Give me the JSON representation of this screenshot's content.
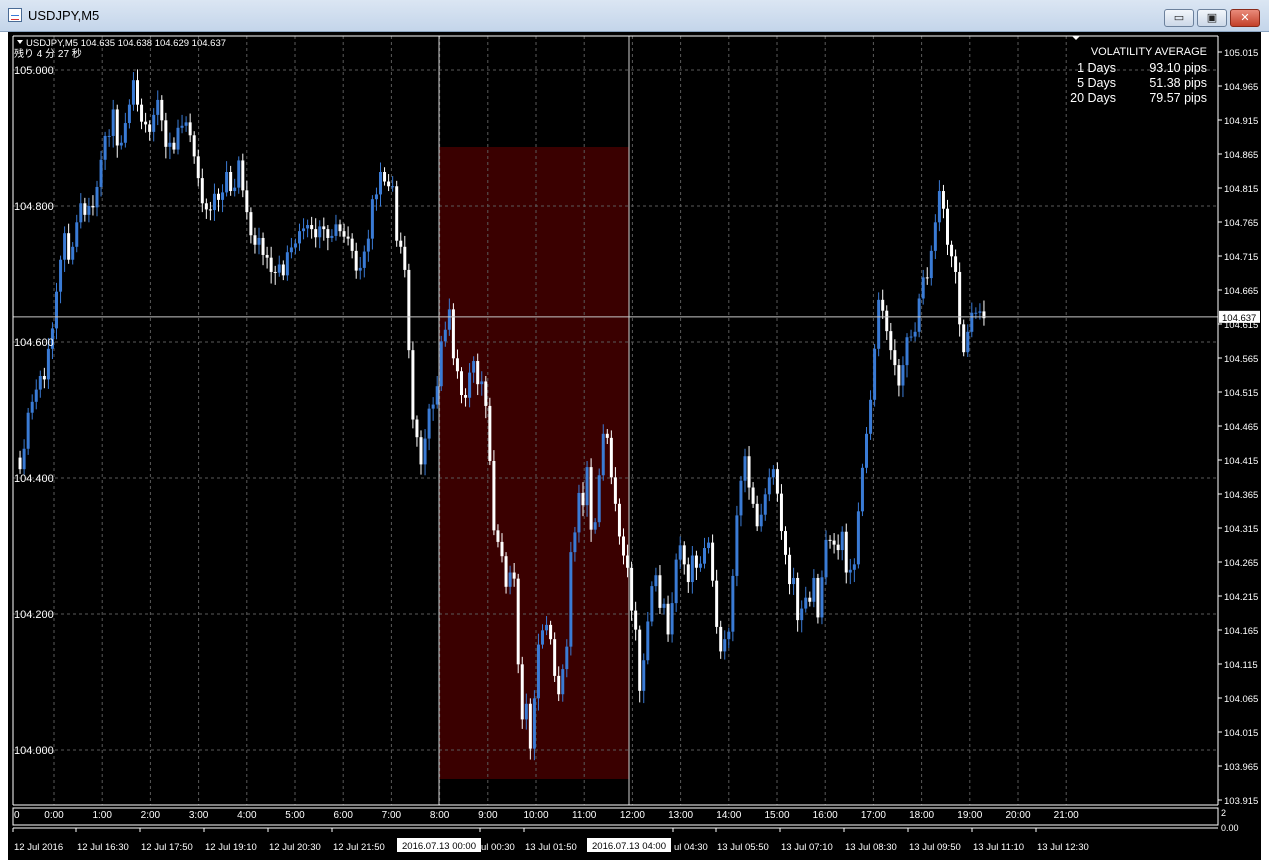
{
  "window": {
    "title": "USDJPY,M5",
    "controls": {
      "minimize": "▭",
      "maximize": "▣",
      "close": "✕"
    }
  },
  "chart_header": {
    "symbol_line": "USDJPY,M5  104.635 104.638 104.629 104.637",
    "countdown": "残り 4 分 27 秒"
  },
  "volatility": {
    "title": "VOLATILITY AVERAGE",
    "rows": [
      {
        "label": "1 Days",
        "value": "93.10 pips"
      },
      {
        "label": "5 Days",
        "value": "51.38 pips"
      },
      {
        "label": "20 Days",
        "value": "79.57 pips"
      }
    ]
  },
  "price_axis": {
    "left_labels": [
      "105.000",
      "104.800",
      "104.600",
      "104.400",
      "104.200",
      "104.000"
    ],
    "right_labels": [
      "105.015",
      "104.965",
      "104.915",
      "104.865",
      "104.815",
      "104.765",
      "104.715",
      "104.665",
      "104.615",
      "104.565",
      "104.515",
      "104.465",
      "104.415",
      "104.365",
      "104.315",
      "104.265",
      "104.215",
      "104.165",
      "104.115",
      "104.065",
      "104.015",
      "103.965",
      "103.915"
    ],
    "current_price": "104.637"
  },
  "time_axis": {
    "hour_labels": [
      "0",
      "0:00",
      "1:00",
      "2:00",
      "3:00",
      "4:00",
      "5:00",
      "6:00",
      "7:00",
      "8:00",
      "9:00",
      "10:00",
      "11:00",
      "12:00",
      "13:00",
      "14:00",
      "15:00",
      "16:00",
      "17:00",
      "18:00",
      "19:00",
      "20:00",
      "21:00"
    ],
    "date_labels": [
      "12 Jul 2016",
      "12 Jul 16:30",
      "12 Jul 17:50",
      "12 Jul 19:10",
      "12 Jul 20:30",
      "12 Jul 21:50",
      "ul 00:30",
      "13 Jul 01:50",
      "ul 04:30",
      "13 Jul 05:50",
      "13 Jul 07:10",
      "13 Jul 08:30",
      "13 Jul 09:50",
      "13 Jul 11:10",
      "13 Jul 12:30"
    ],
    "cursor_labels": [
      "2016.07.13 00:00",
      "2016.07.13 04:00"
    ]
  },
  "indicator_pane": {
    "scale_top": "2",
    "scale_bottom": "0.00"
  },
  "colors": {
    "background": "#000000",
    "bull": "#3a7bd5",
    "bear": "#ffffff",
    "range_box": "#3a0000",
    "grid": "#5a5a5a"
  },
  "chart_data": {
    "type": "candlestick",
    "series": [
      {
        "values": [
          104.43,
          104.413,
          104.443,
          104.496,
          104.512,
          104.53,
          104.55,
          104.545,
          104.59,
          104.62,
          104.674,
          104.721,
          104.76,
          104.721,
          104.74,
          104.776,
          104.804,
          104.787,
          104.8,
          104.798,
          104.828,
          104.868,
          104.903,
          104.903,
          104.942,
          104.889,
          104.893,
          104.922,
          104.949,
          104.985,
          104.949,
          104.924,
          104.92,
          104.909,
          104.934,
          104.956,
          104.926,
          104.887,
          104.893,
          104.883,
          104.915,
          104.918,
          104.923,
          104.904,
          104.873,
          104.841,
          104.804,
          104.795,
          104.794,
          104.818,
          104.809,
          104.82,
          104.85,
          104.822,
          104.827,
          104.867,
          104.823,
          104.791,
          104.757,
          104.743,
          104.753,
          104.728,
          104.724,
          104.703,
          104.702,
          104.714,
          104.698,
          104.732,
          104.739,
          104.745,
          104.763,
          104.767,
          104.772,
          104.766,
          104.754,
          104.77,
          104.766,
          104.753,
          104.756,
          104.773,
          104.763,
          104.755,
          104.752,
          104.734,
          104.705,
          104.709,
          104.733,
          104.752,
          104.81,
          104.817,
          104.85,
          104.836,
          104.829,
          104.829,
          104.749,
          104.74,
          104.706,
          104.588,
          104.486,
          104.46,
          104.42,
          104.458,
          104.502,
          104.508,
          104.535,
          104.601,
          104.618,
          104.648,
          104.576,
          104.557,
          104.522,
          104.518,
          104.555,
          104.572,
          104.538,
          104.542,
          104.506,
          104.425,
          104.323,
          104.306,
          104.285,
          104.24,
          104.261,
          104.252,
          104.126,
          104.045,
          104.068,
          104.002,
          104.076,
          104.155,
          104.176,
          104.184,
          104.163,
          104.109,
          104.082,
          104.119,
          104.152,
          104.291,
          104.32,
          104.378,
          104.36,
          104.416,
          104.324,
          104.335,
          104.404,
          104.465,
          104.459,
          104.401,
          104.362,
          104.314,
          104.286,
          104.268,
          104.205,
          104.177,
          104.087,
          104.132,
          104.189,
          104.241,
          104.257,
          104.209,
          104.215,
          104.17,
          104.216,
          104.28,
          104.301,
          104.273,
          104.247,
          104.286,
          104.268,
          104.274,
          104.297,
          104.305,
          104.249,
          104.181,
          104.145,
          104.163,
          104.174,
          104.256,
          104.345,
          104.396,
          104.432,
          104.386,
          104.362,
          104.329,
          104.346,
          104.376,
          104.401,
          104.413,
          104.377,
          104.322,
          104.287,
          104.244,
          104.253,
          104.191,
          104.208,
          104.224,
          104.218,
          104.253,
          104.195,
          104.254,
          104.309,
          104.308,
          104.302,
          104.294,
          104.321,
          104.261,
          104.265,
          104.273,
          104.351,
          104.415,
          104.465,
          104.515,
          104.59,
          104.662,
          104.646,
          104.616,
          104.588,
          104.566,
          104.536,
          104.566,
          104.607,
          104.608,
          104.615,
          104.664,
          104.695,
          104.694,
          104.734,
          104.776,
          104.822,
          104.796,
          104.743,
          104.726,
          104.703,
          104.626,
          104.585,
          104.615,
          104.643,
          104.643,
          104.645,
          104.635
        ]
      }
    ],
    "ylim": [
      103.9,
      105.02
    ]
  }
}
